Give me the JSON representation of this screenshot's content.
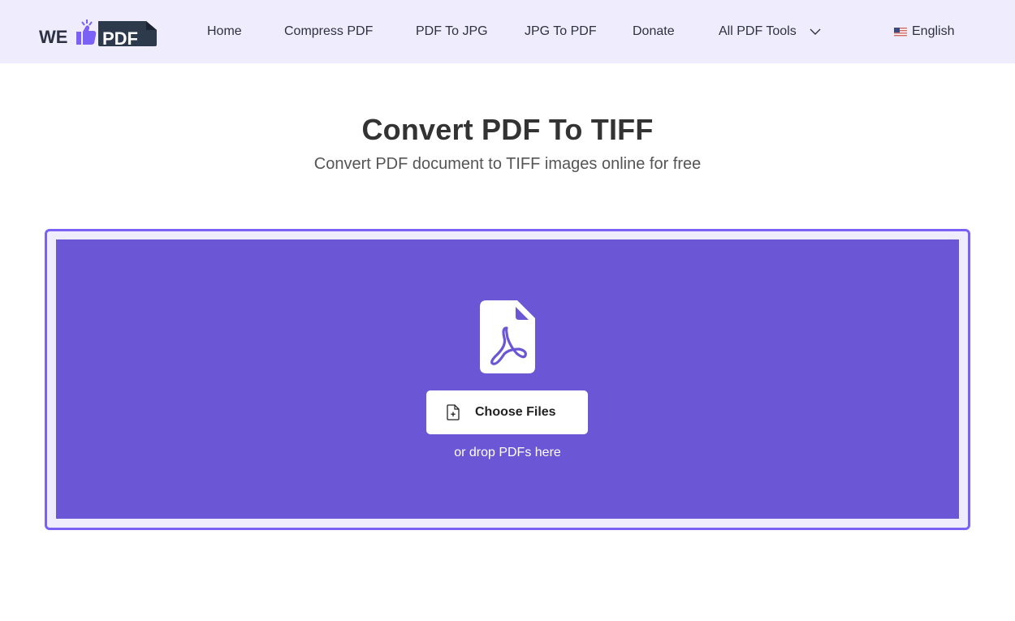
{
  "header": {
    "logo": {
      "text_left": "WE",
      "text_right": "PDF",
      "icon": "thumbs-up-icon"
    },
    "nav": [
      {
        "label": "Home"
      },
      {
        "label": "Compress PDF"
      },
      {
        "label": "PDF To JPG"
      },
      {
        "label": "JPG To PDF"
      },
      {
        "label": "Donate"
      },
      {
        "label": "All PDF Tools",
        "icon": "chevron-down-icon"
      }
    ],
    "language": {
      "label": "English",
      "icon": "us-flag-icon"
    }
  },
  "main": {
    "title": "Convert PDF To TIFF",
    "subtitle": "Convert PDF document to TIFF images online for free",
    "upload": {
      "icon": "pdf-file-icon",
      "button_label": "Choose Files",
      "button_icon": "file-plus-icon",
      "drop_hint": "or drop PDFs here"
    }
  },
  "colors": {
    "header_bg": "#efedfd",
    "accent": "#7b61f5",
    "dropzone_bg": "#6b56d6",
    "text_dark": "#2d3142"
  }
}
